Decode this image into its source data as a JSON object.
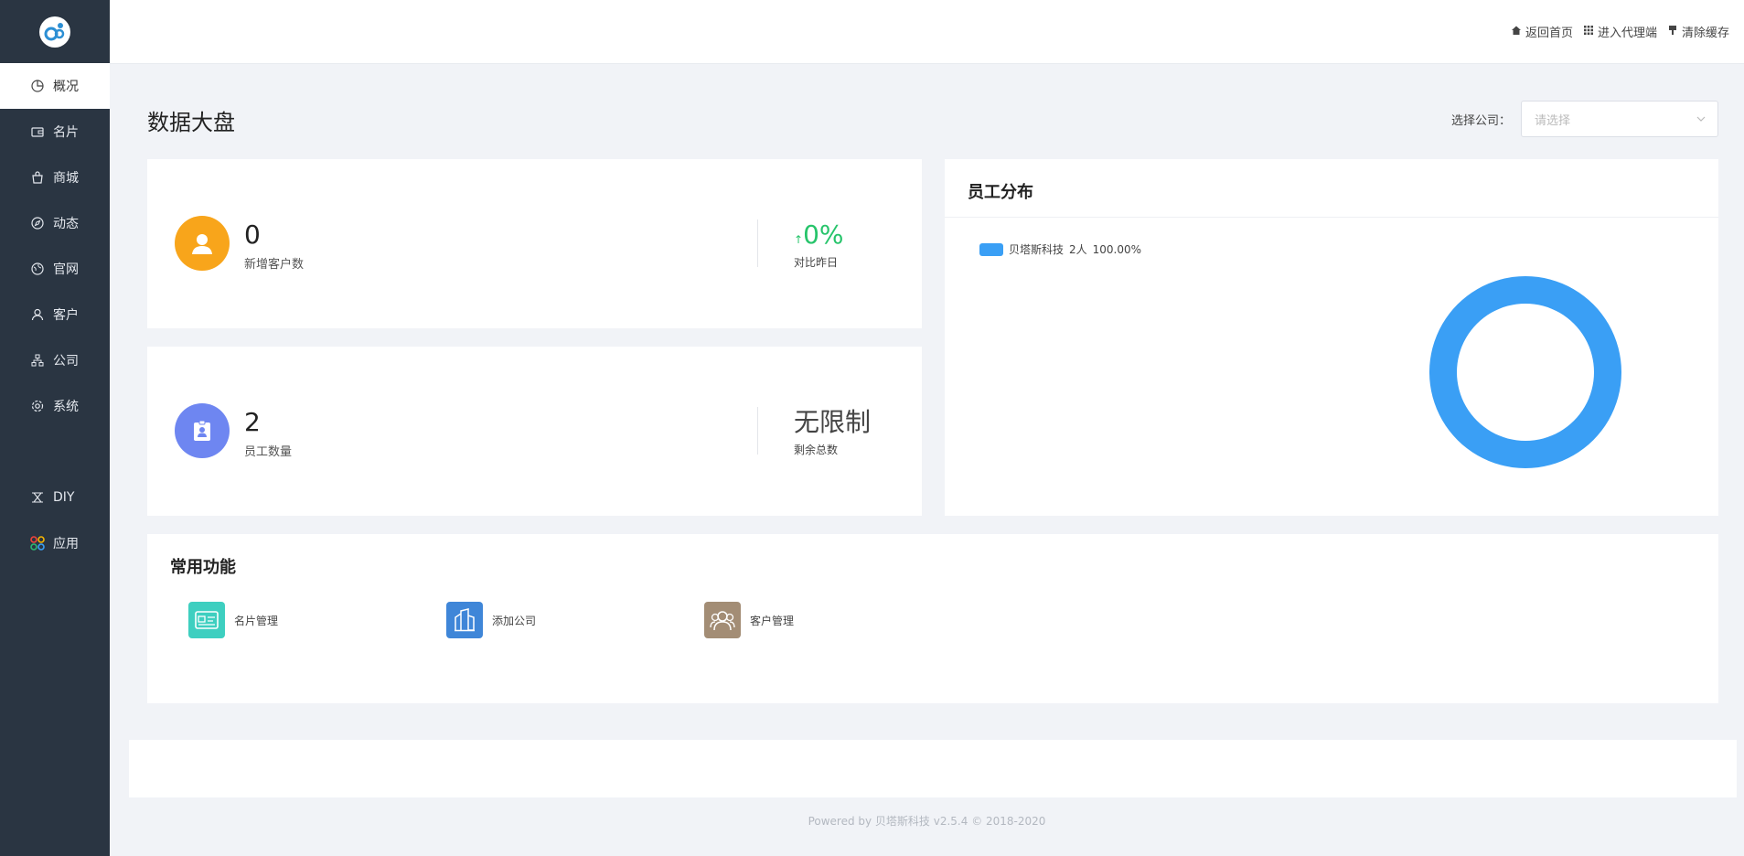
{
  "colors": {
    "sidebar_bg": "#2a3542",
    "accent_blue": "#3a9ff5",
    "orange": "#f8a51b",
    "indigo": "#6e86f1",
    "green": "#27c46b",
    "teal": "#3ecfc0",
    "blue": "#3f86d8",
    "brown": "#a38d75"
  },
  "sidebar": {
    "items": [
      {
        "label": "概况",
        "icon": "pie-chart-icon",
        "active": true
      },
      {
        "label": "名片",
        "icon": "wallet-icon"
      },
      {
        "label": "商城",
        "icon": "shopping-bag-icon"
      },
      {
        "label": "动态",
        "icon": "compass-icon"
      },
      {
        "label": "官网",
        "icon": "globe-icon"
      },
      {
        "label": "客户",
        "icon": "user-icon"
      },
      {
        "label": "公司",
        "icon": "org-chart-icon"
      },
      {
        "label": "系统",
        "icon": "gear-icon"
      }
    ],
    "extra": [
      {
        "label": "DIY",
        "icon": "diy-icon"
      },
      {
        "label": "应用",
        "icon": "apps-icon"
      }
    ]
  },
  "header": {
    "links": [
      {
        "label": "返回首页",
        "icon": "home-icon"
      },
      {
        "label": "进入代理端",
        "icon": "grid-icon"
      },
      {
        "label": "清除缓存",
        "icon": "brush-icon"
      }
    ]
  },
  "main": {
    "title": "数据大盘",
    "company_label": "选择公司：",
    "company_placeholder": "请选择"
  },
  "stats": {
    "new_customers": {
      "value": "0",
      "label": "新增客户数",
      "change": "0%",
      "change_label": "对比昨日",
      "arrow": "↑"
    },
    "employees": {
      "value": "2",
      "label": "员工数量",
      "remaining": "无限制",
      "remaining_label": "剩余总数"
    }
  },
  "distribution": {
    "title": "员工分布",
    "legend": [
      {
        "name": "贝塔斯科技",
        "count": "2人",
        "percent": "100.00%"
      }
    ]
  },
  "chart_data": {
    "type": "pie",
    "title": "员工分布",
    "categories": [
      "贝塔斯科技"
    ],
    "values": [
      2
    ],
    "percent": [
      100.0
    ]
  },
  "functions": {
    "title": "常用功能",
    "items": [
      {
        "label": "名片管理",
        "icon": "card-icon"
      },
      {
        "label": "添加公司",
        "icon": "building-icon"
      },
      {
        "label": "客户管理",
        "icon": "users-icon"
      }
    ]
  },
  "footer": {
    "text": "Powered by 贝塔斯科技 v2.5.4 © 2018-2020"
  }
}
